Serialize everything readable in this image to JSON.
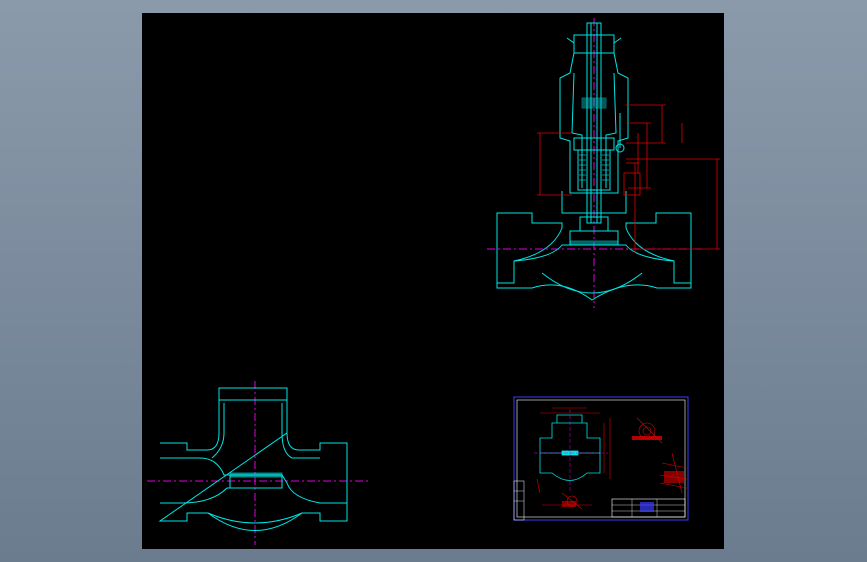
{
  "colors": {
    "page_bg": "#7a8a9c",
    "canvas_bg": "#000000",
    "outline": "#00e5e5",
    "centerline": "#e000e0",
    "dimension": "#e00000",
    "hatch": "#00c8c8",
    "sheet_border": "#3a3aff",
    "white": "#ffffff"
  },
  "views": {
    "section_view": "valve-vertical-section",
    "body_view": "valve-body-section",
    "sheet_thumbnail": "drawing-sheet-preview"
  }
}
